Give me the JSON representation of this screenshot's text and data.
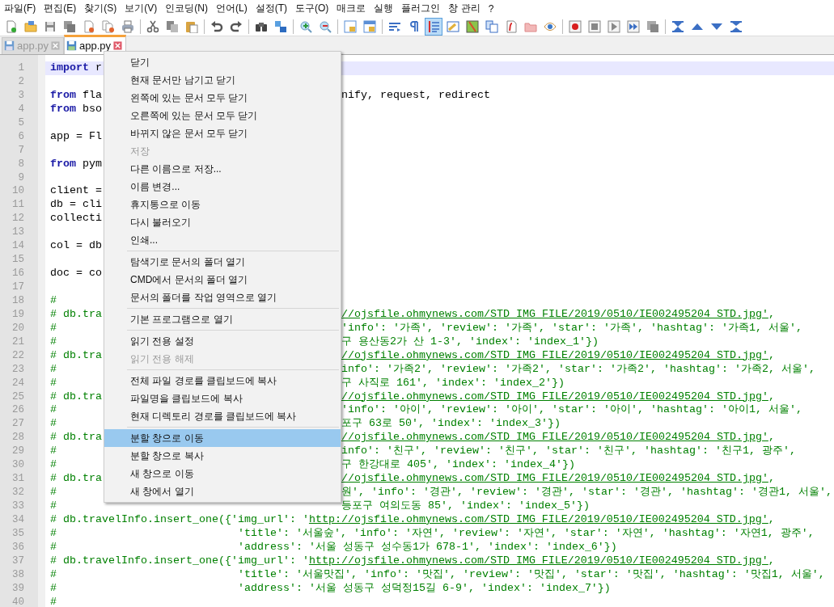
{
  "menubar": [
    "파일(F)",
    "편집(E)",
    "찾기(S)",
    "보기(V)",
    "인코딩(N)",
    "언어(L)",
    "설정(T)",
    "도구(O)",
    "매크로",
    "실행",
    "플러그인",
    "창 관리",
    "?"
  ],
  "toolbar": [
    {
      "kind": "new",
      "selected": false
    },
    {
      "kind": "open",
      "selected": false
    },
    {
      "kind": "save",
      "selected": false
    },
    {
      "kind": "save-all",
      "selected": false
    },
    {
      "kind": "close",
      "selected": false
    },
    {
      "kind": "close-all",
      "selected": false
    },
    {
      "kind": "print",
      "selected": false
    },
    {
      "kind": "separator"
    },
    {
      "kind": "cut",
      "selected": false
    },
    {
      "kind": "copy",
      "selected": false
    },
    {
      "kind": "paste",
      "selected": false
    },
    {
      "kind": "separator"
    },
    {
      "kind": "undo",
      "selected": false
    },
    {
      "kind": "redo",
      "selected": false
    },
    {
      "kind": "separator"
    },
    {
      "kind": "find",
      "selected": false
    },
    {
      "kind": "replace",
      "selected": false
    },
    {
      "kind": "separator"
    },
    {
      "kind": "zoom-in",
      "selected": false
    },
    {
      "kind": "zoom-out",
      "selected": false
    },
    {
      "kind": "separator"
    },
    {
      "kind": "sync-v",
      "selected": false
    },
    {
      "kind": "sync-h",
      "selected": false
    },
    {
      "kind": "separator"
    },
    {
      "kind": "wrap",
      "selected": false
    },
    {
      "kind": "pilcrow",
      "selected": false
    },
    {
      "kind": "indent",
      "selected": true
    },
    {
      "kind": "udl",
      "selected": false
    },
    {
      "kind": "map",
      "selected": false
    },
    {
      "kind": "docs",
      "selected": false
    },
    {
      "kind": "function",
      "selected": false
    },
    {
      "kind": "folder",
      "selected": false
    },
    {
      "kind": "eye",
      "selected": false
    },
    {
      "kind": "separator"
    },
    {
      "kind": "record",
      "selected": false
    },
    {
      "kind": "stop",
      "selected": false
    },
    {
      "kind": "play",
      "selected": false
    },
    {
      "kind": "play-multi",
      "selected": false
    },
    {
      "kind": "save-macro",
      "selected": false
    },
    {
      "kind": "separator"
    },
    {
      "kind": "first",
      "selected": false
    },
    {
      "kind": "up",
      "selected": false
    },
    {
      "kind": "down",
      "selected": false
    },
    {
      "kind": "last",
      "selected": false
    }
  ],
  "tabs": [
    {
      "label": "app.py",
      "selected": false
    },
    {
      "label": "app.py",
      "selected": true
    }
  ],
  "lines": [
    {
      "number": "1",
      "current": true,
      "left": [
        {
          "text": "import",
          "kind": "keyword"
        },
        {
          "text": " r",
          "kind": "text"
        }
      ]
    },
    {
      "number": "2",
      "current": false
    },
    {
      "number": "3",
      "current": false,
      "left": [
        {
          "text": "from",
          "kind": "keyword"
        },
        {
          "text": " fla",
          "kind": "text"
        }
      ],
      "right": [
        {
          "text": "nify, request, redirect",
          "kind": "text"
        }
      ]
    },
    {
      "number": "4",
      "current": false,
      "left": [
        {
          "text": "from",
          "kind": "keyword"
        },
        {
          "text": " bso",
          "kind": "text"
        }
      ]
    },
    {
      "number": "5",
      "current": false
    },
    {
      "number": "6",
      "current": false,
      "left": [
        {
          "text": "app = Fl",
          "kind": "text"
        }
      ]
    },
    {
      "number": "7",
      "current": false
    },
    {
      "number": "8",
      "current": false,
      "left": [
        {
          "text": "from",
          "kind": "keyword"
        },
        {
          "text": " pym",
          "kind": "text"
        }
      ]
    },
    {
      "number": "9",
      "current": false
    },
    {
      "number": "10",
      "current": false,
      "left": [
        {
          "text": "client =",
          "kind": "text"
        }
      ]
    },
    {
      "number": "11",
      "current": false,
      "left": [
        {
          "text": "db = cli",
          "kind": "text"
        }
      ]
    },
    {
      "number": "12",
      "current": false,
      "left": [
        {
          "text": "collecti",
          "kind": "text"
        }
      ]
    },
    {
      "number": "13",
      "current": false
    },
    {
      "number": "14",
      "current": false,
      "left": [
        {
          "text": "col = db",
          "kind": "text"
        }
      ]
    },
    {
      "number": "15",
      "current": false
    },
    {
      "number": "16",
      "current": false,
      "left": [
        {
          "text": "doc = co",
          "kind": "text"
        }
      ]
    },
    {
      "number": "17",
      "current": false
    },
    {
      "number": "18",
      "current": false,
      "left": [
        {
          "text": "#",
          "kind": "comment"
        }
      ]
    },
    {
      "number": "19",
      "current": false,
      "left": [
        {
          "text": "# db.tra",
          "kind": "comment"
        }
      ],
      "right": [
        {
          "text": "//ojsfile.ohmynews.com/STD_IMG_FILE/2019/0510/IE002495204_STD.jpg'",
          "kind": "link"
        },
        {
          "text": ",",
          "kind": "comment"
        }
      ]
    },
    {
      "number": "20",
      "current": false,
      "left": [
        {
          "text": "#",
          "kind": "comment"
        }
      ],
      "right": [
        {
          "text": "'info': '가족', 'review': '가족', 'star': '가족', 'hashtag': '가족1, 서울',",
          "kind": "comment"
        }
      ]
    },
    {
      "number": "21",
      "current": false,
      "left": [
        {
          "text": "#",
          "kind": "comment"
        }
      ],
      "right": [
        {
          "text": "구 용산동2가 산 1-3', 'index': 'index_1'})",
          "kind": "comment"
        }
      ]
    },
    {
      "number": "22",
      "current": false,
      "left": [
        {
          "text": "# db.tra",
          "kind": "comment"
        }
      ],
      "right": [
        {
          "text": "//ojsfile.ohmynews.com/STD_IMG_FILE/2019/0510/IE002495204_STD.jpg'",
          "kind": "link"
        },
        {
          "text": ",",
          "kind": "comment"
        }
      ]
    },
    {
      "number": "23",
      "current": false,
      "left": [
        {
          "text": "#",
          "kind": "comment"
        }
      ],
      "right": [
        {
          "text": "info': '가족2', 'review': '가족2', 'star': '가족2', 'hashtag': '가족2, 서울',",
          "kind": "comment"
        }
      ]
    },
    {
      "number": "24",
      "current": false,
      "left": [
        {
          "text": "#",
          "kind": "comment"
        }
      ],
      "right": [
        {
          "text": "구 사직로 161', 'index': 'index_2'})",
          "kind": "comment"
        }
      ]
    },
    {
      "number": "25",
      "current": false,
      "left": [
        {
          "text": "# db.tra",
          "kind": "comment"
        }
      ],
      "right": [
        {
          "text": "//ojsfile.ohmynews.com/STD_IMG_FILE/2019/0510/IE002495204_STD.jpg'",
          "kind": "link"
        },
        {
          "text": ",",
          "kind": "comment"
        }
      ]
    },
    {
      "number": "26",
      "current": false,
      "left": [
        {
          "text": "#",
          "kind": "comment"
        }
      ],
      "right": [
        {
          "text": "'info': '아이', 'review': '아이', 'star': '아이', 'hashtag': '아이1, 서울',",
          "kind": "comment"
        }
      ]
    },
    {
      "number": "27",
      "current": false,
      "left": [
        {
          "text": "#",
          "kind": "comment"
        }
      ],
      "right": [
        {
          "text": "포구 63로 50', 'index': 'index_3'})",
          "kind": "comment"
        }
      ]
    },
    {
      "number": "28",
      "current": false,
      "left": [
        {
          "text": "# db.tra",
          "kind": "comment"
        }
      ],
      "right": [
        {
          "text": "//ojsfile.ohmynews.com/STD_IMG_FILE/2019/0510/IE002495204_STD.jpg'",
          "kind": "link"
        },
        {
          "text": ",",
          "kind": "comment"
        }
      ]
    },
    {
      "number": "29",
      "current": false,
      "left": [
        {
          "text": "#",
          "kind": "comment"
        }
      ],
      "right": [
        {
          "text": "info': '친구', 'review': '친구', 'star': '친구', 'hashtag': '친구1, 광주',",
          "kind": "comment"
        }
      ]
    },
    {
      "number": "30",
      "current": false,
      "left": [
        {
          "text": "#",
          "kind": "comment"
        }
      ],
      "right": [
        {
          "text": "구 한강대로 405', 'index': 'index_4'})",
          "kind": "comment"
        }
      ]
    },
    {
      "number": "31",
      "current": false,
      "left": [
        {
          "text": "# db.tra",
          "kind": "comment"
        }
      ],
      "right": [
        {
          "text": "//ojsfile.ohmynews.com/STD_IMG_FILE/2019/0510/IE002495204_STD.jpg'",
          "kind": "link"
        },
        {
          "text": ",",
          "kind": "comment"
        }
      ]
    },
    {
      "number": "32",
      "current": false,
      "left": [
        {
          "text": "#",
          "kind": "comment"
        }
      ],
      "right": [
        {
          "text": "원', 'info': '경관', 'review': '경관', 'star': '경관', 'hashtag': '경관1, 서울',",
          "kind": "comment"
        }
      ]
    },
    {
      "number": "33",
      "current": false,
      "left": [
        {
          "text": "#",
          "kind": "comment"
        }
      ],
      "right": [
        {
          "text": "등포구 여의도동 85', 'index': 'index_5'})",
          "kind": "comment"
        }
      ]
    },
    {
      "number": "34",
      "current": false,
      "left": [
        {
          "text": "# db.travelInfo.insert_one({'img_url': '",
          "kind": "comment"
        },
        {
          "text": "http://ojsfile.ohmynews.com/STD_IMG_FILE/2019/0510/IE002495204_STD.jpg'",
          "kind": "link"
        },
        {
          "text": ",",
          "kind": "comment"
        }
      ]
    },
    {
      "number": "35",
      "current": false,
      "left": [
        {
          "text": "#                            'title': '서울숲', 'info': '자연', 'review': '자연', 'star': '자연', 'hashtag': '자연1, 광주',",
          "kind": "comment"
        }
      ]
    },
    {
      "number": "36",
      "current": false,
      "left": [
        {
          "text": "#                            'address': '서울 성동구 성수동1가 678-1', 'index': 'index_6'})",
          "kind": "comment"
        }
      ]
    },
    {
      "number": "37",
      "current": false,
      "left": [
        {
          "text": "# db.travelInfo.insert_one({'img_url': '",
          "kind": "comment"
        },
        {
          "text": "http://ojsfile.ohmynews.com/STD_IMG_FILE/2019/0510/IE002495204_STD.jpg'",
          "kind": "link"
        },
        {
          "text": ",",
          "kind": "comment"
        }
      ]
    },
    {
      "number": "38",
      "current": false,
      "left": [
        {
          "text": "#                            'title': '서울맛집', 'info': '맛집', 'review': '맛집', 'star': '맛집', 'hashtag': '맛집1, 서울',",
          "kind": "comment"
        }
      ]
    },
    {
      "number": "39",
      "current": false,
      "left": [
        {
          "text": "#                            'address': '서울 성동구 성덕정15길 6-9', 'index': 'index_7'})",
          "kind": "comment"
        }
      ]
    },
    {
      "number": "40",
      "current": false,
      "left": [
        {
          "text": "#",
          "kind": "comment"
        }
      ]
    }
  ],
  "context_menu": {
    "groups": [
      [
        {
          "label": "닫기",
          "disabled": false,
          "selected": false
        },
        {
          "label": "현재 문서만 남기고 닫기",
          "disabled": false,
          "selected": false
        },
        {
          "label": "왼쪽에 있는 문서 모두 닫기",
          "disabled": false,
          "selected": false
        },
        {
          "label": "오른쪽에 있는 문서 모두 닫기",
          "disabled": false,
          "selected": false
        },
        {
          "label": "바뀌지 않은 문서 모두 닫기",
          "disabled": false,
          "selected": false
        },
        {
          "label": "저장",
          "disabled": true,
          "selected": false
        },
        {
          "label": "다른 이름으로 저장...",
          "disabled": false,
          "selected": false
        },
        {
          "label": "이름 변경...",
          "disabled": false,
          "selected": false
        },
        {
          "label": "휴지통으로 이동",
          "disabled": false,
          "selected": false
        },
        {
          "label": "다시 불러오기",
          "disabled": false,
          "selected": false
        },
        {
          "label": "인쇄...",
          "disabled": false,
          "selected": false
        }
      ],
      [
        {
          "label": "탐색기로 문서의 폴더 열기",
          "disabled": false,
          "selected": false
        },
        {
          "label": "CMD에서 문서의 폴더 열기",
          "disabled": false,
          "selected": false
        },
        {
          "label": "문서의 폴더를 작업 영역으로 열기",
          "disabled": false,
          "selected": false
        }
      ],
      [
        {
          "label": "기본 프로그램으로 열기",
          "disabled": false,
          "selected": false
        }
      ],
      [
        {
          "label": "읽기 전용 설정",
          "disabled": false,
          "selected": false
        },
        {
          "label": "읽기 전용 해제",
          "disabled": true,
          "selected": false
        }
      ],
      [
        {
          "label": "전체 파일 경로를 클립보드에 복사",
          "disabled": false,
          "selected": false
        },
        {
          "label": "파일명을 클립보드에 복사",
          "disabled": false,
          "selected": false
        },
        {
          "label": "현재 디렉토리 경로를 클립보드에 복사",
          "disabled": false,
          "selected": false
        }
      ],
      [
        {
          "label": "분할 창으로 이동",
          "disabled": false,
          "selected": true
        },
        {
          "label": "분할 창으로 복사",
          "disabled": false,
          "selected": false
        },
        {
          "label": "새 창으로 이동",
          "disabled": false,
          "selected": false
        },
        {
          "label": "새 창에서 열기",
          "disabled": false,
          "selected": false
        }
      ]
    ]
  }
}
